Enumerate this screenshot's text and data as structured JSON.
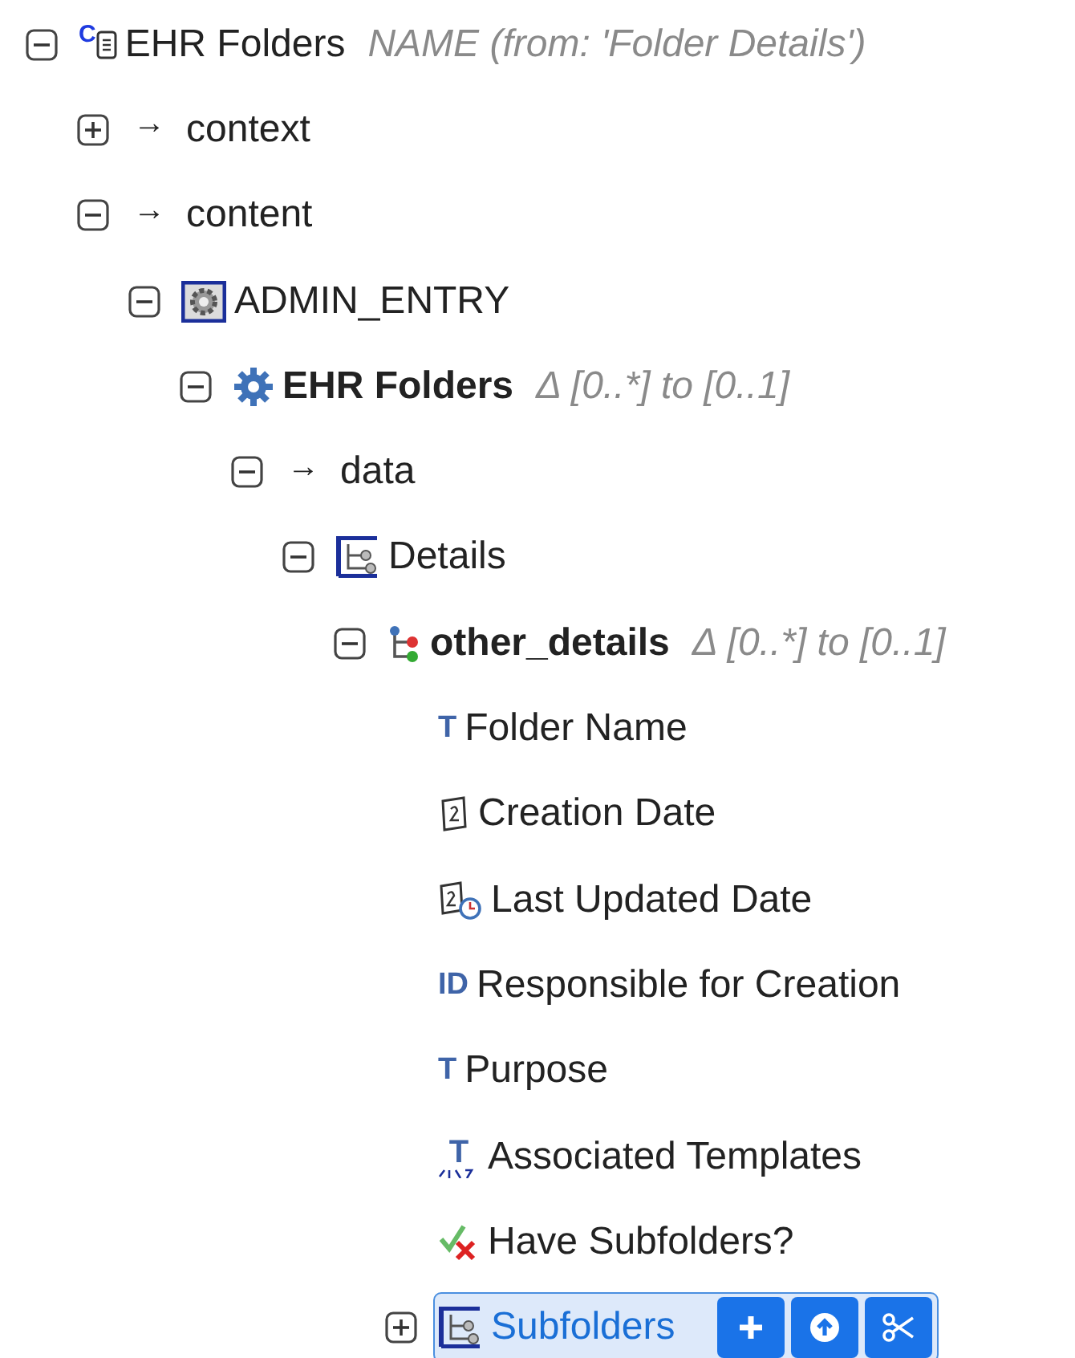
{
  "tree": [
    {
      "label": "EHR Folders",
      "kind": "composition",
      "glyph": "C",
      "note": "NAME (from: 'Folder Details')",
      "bold": false,
      "expanded": true,
      "selected": false,
      "children": [
        {
          "label": "context",
          "kind": "arrow",
          "glyph": "→",
          "bold": false,
          "expanded": false,
          "selected": false
        },
        {
          "label": "content",
          "kind": "arrow",
          "glyph": "→",
          "bold": false,
          "expanded": true,
          "selected": false,
          "children": [
            {
              "label": "ADMIN_ENTRY",
              "kind": "admin_entry",
              "bold": false,
              "expanded": true,
              "selected": false,
              "children": [
                {
                  "label": "EHR Folders",
                  "kind": "entry",
                  "note": "Δ [0..*] to [0..1]",
                  "bold": true,
                  "expanded": true,
                  "selected": false,
                  "children": [
                    {
                      "label": "data",
                      "kind": "arrow",
                      "glyph": "→",
                      "bold": false,
                      "expanded": true,
                      "selected": false,
                      "children": [
                        {
                          "label": "Details",
                          "kind": "item_tree",
                          "bold": false,
                          "expanded": true,
                          "selected": false,
                          "children": [
                            {
                              "label": "other_details",
                              "kind": "cluster",
                              "note": "Δ [0..*] to [0..1]",
                              "bold": true,
                              "expanded": true,
                              "selected": false,
                              "children": [
                                {
                                  "label": "Folder Name",
                                  "kind": "text",
                                  "glyph": "T",
                                  "bold": false,
                                  "selected": false
                                },
                                {
                                  "label": "Creation Date",
                                  "kind": "date",
                                  "bold": false,
                                  "selected": false
                                },
                                {
                                  "label": "Last Updated Date",
                                  "kind": "datetime",
                                  "bold": false,
                                  "selected": false
                                },
                                {
                                  "label": "Responsible for Creation",
                                  "kind": "text",
                                  "glyph": "ID",
                                  "bold": false,
                                  "selected": false
                                },
                                {
                                  "label": "Purpose",
                                  "kind": "text",
                                  "glyph": "T",
                                  "bold": false,
                                  "selected": false
                                },
                                {
                                  "label": "Associated Templates",
                                  "kind": "coded_text",
                                  "glyph": "T",
                                  "bold": false,
                                  "selected": false
                                },
                                {
                                  "label": "Have Subfolders?",
                                  "kind": "boolean",
                                  "bold": false,
                                  "selected": false
                                },
                                {
                                  "label": "Subfolders",
                                  "kind": "item_tree",
                                  "bold": false,
                                  "expanded": false,
                                  "selected": true
                                }
                              ]
                            }
                          ]
                        }
                      ]
                    }
                  ]
                }
              ]
            }
          ]
        }
      ]
    }
  ]
}
